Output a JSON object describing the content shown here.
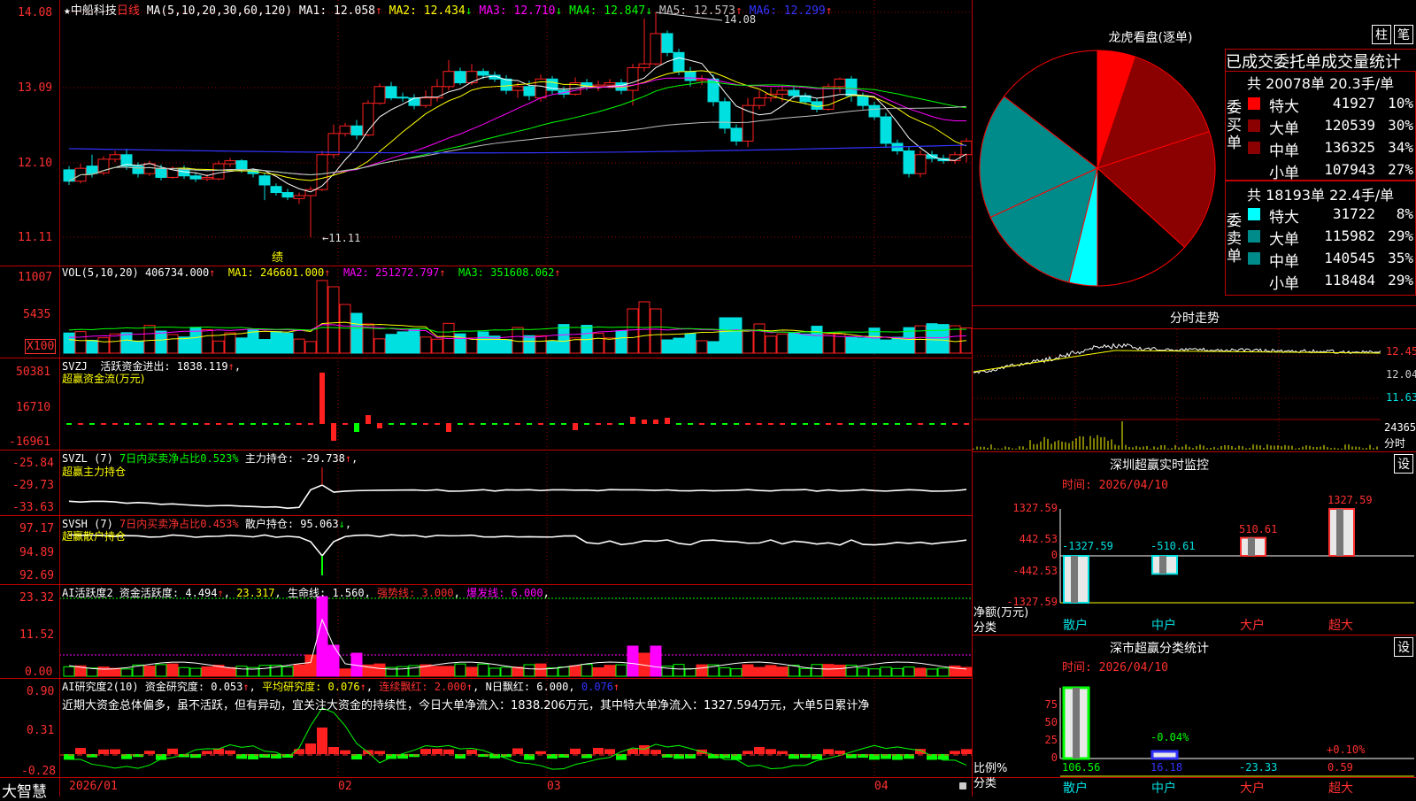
{
  "app": {
    "logo": "大智慧"
  },
  "stock": {
    "star": "★",
    "name": "中船科技",
    "period": "日线",
    "ma_def": "MA(5,10,20,30,60,120)",
    "ma_values": [
      {
        "label": "MA1:",
        "value": "12.058",
        "arrow": "↑",
        "color": "#ffffff"
      },
      {
        "label": "MA2:",
        "value": "12.434",
        "arrow": "↓",
        "color": "#ffff00"
      },
      {
        "label": "MA3:",
        "value": "12.710",
        "arrow": "↓",
        "color": "#ff00ff"
      },
      {
        "label": "MA4:",
        "value": "12.847",
        "arrow": "↓",
        "color": "#00ff00"
      },
      {
        "label": "MA5:",
        "value": "12.573",
        "arrow": "↑",
        "color": "#c0c0c0"
      },
      {
        "label": "MA6:",
        "value": "12.299",
        "arrow": "↑",
        "color": "#3333ff"
      }
    ]
  },
  "main": {
    "yticks": [
      "14.08",
      "13.09",
      "12.10",
      "11.11"
    ],
    "max_label": "14.08",
    "min_label": "←11.11",
    "event_label": "绩",
    "date_ticks": [
      "2026/01",
      "02",
      "03",
      "04"
    ]
  },
  "colors": {
    "up": "#ff2020",
    "down": "#00e0e0",
    "grid": "#9b0000",
    "axis": "#ff3030"
  },
  "candles": [
    [
      12.0,
      11.85,
      12.05,
      11.8
    ],
    [
      11.85,
      12.02,
      12.08,
      11.82
    ],
    [
      12.05,
      11.95,
      12.2,
      11.9
    ],
    [
      11.96,
      12.14,
      12.18,
      11.93
    ],
    [
      12.14,
      12.2,
      12.25,
      12.1
    ],
    [
      12.2,
      12.05,
      12.28,
      12.0
    ],
    [
      12.05,
      11.95,
      12.1,
      11.9
    ],
    [
      11.95,
      12.08,
      12.12,
      11.92
    ],
    [
      12.02,
      11.9,
      12.07,
      11.86
    ],
    [
      11.9,
      12.02,
      12.05,
      11.88
    ],
    [
      12.02,
      11.92,
      12.06,
      11.88
    ],
    [
      11.92,
      11.88,
      11.96,
      11.84
    ],
    [
      11.88,
      11.9,
      11.94,
      11.85
    ],
    [
      11.88,
      12.08,
      12.12,
      11.86
    ],
    [
      12.08,
      12.12,
      12.16,
      12.04
    ],
    [
      12.12,
      12.0,
      12.14,
      11.96
    ],
    [
      12.0,
      11.95,
      12.02,
      11.9
    ],
    [
      11.92,
      11.8,
      11.96,
      11.6
    ],
    [
      11.78,
      11.7,
      11.82,
      11.66
    ],
    [
      11.7,
      11.64,
      11.75,
      11.6
    ],
    [
      11.62,
      11.66,
      11.7,
      11.55
    ],
    [
      11.66,
      11.74,
      11.78,
      11.11
    ],
    [
      11.74,
      12.2,
      12.25,
      11.72
    ],
    [
      12.2,
      12.48,
      12.6,
      12.15
    ],
    [
      12.48,
      12.58,
      12.62,
      12.44
    ],
    [
      12.58,
      12.46,
      12.66,
      12.4
    ],
    [
      12.46,
      12.88,
      12.92,
      12.44
    ],
    [
      12.88,
      13.1,
      13.14,
      12.86
    ],
    [
      13.1,
      12.95,
      13.16,
      12.92
    ],
    [
      12.96,
      12.95,
      13.02,
      12.9
    ],
    [
      12.95,
      12.85,
      13.0,
      12.8
    ],
    [
      12.85,
      12.95,
      13.05,
      12.82
    ],
    [
      12.95,
      13.1,
      13.2,
      12.9
    ],
    [
      13.1,
      13.3,
      13.45,
      13.05
    ],
    [
      13.3,
      13.15,
      13.35,
      13.12
    ],
    [
      13.15,
      13.3,
      13.4,
      13.12
    ],
    [
      13.3,
      13.25,
      13.34,
      13.2
    ],
    [
      13.25,
      13.2,
      13.3,
      13.16
    ],
    [
      13.2,
      13.05,
      13.25,
      13.0
    ],
    [
      13.05,
      13.1,
      13.15,
      12.95
    ],
    [
      13.1,
      12.98,
      13.18,
      12.92
    ],
    [
      12.95,
      13.2,
      13.26,
      12.9
    ],
    [
      13.2,
      13.05,
      13.24,
      13.0
    ],
    [
      13.05,
      13.0,
      13.1,
      12.95
    ],
    [
      13.0,
      13.15,
      13.22,
      12.98
    ],
    [
      13.15,
      13.1,
      13.2,
      13.05
    ],
    [
      13.1,
      13.12,
      13.18,
      13.04
    ],
    [
      13.12,
      13.15,
      13.2,
      13.08
    ],
    [
      13.15,
      13.05,
      13.2,
      13.0
    ],
    [
      13.05,
      13.35,
      13.4,
      12.85
    ],
    [
      13.35,
      13.4,
      14.0,
      13.3
    ],
    [
      13.4,
      13.8,
      14.08,
      13.38
    ],
    [
      13.8,
      13.55,
      13.84,
      13.5
    ],
    [
      13.55,
      13.3,
      13.6,
      13.25
    ],
    [
      13.3,
      13.18,
      13.36,
      13.1
    ],
    [
      13.18,
      13.2,
      13.25,
      13.12
    ],
    [
      13.2,
      12.9,
      13.26,
      12.84
    ],
    [
      12.9,
      12.55,
      12.95,
      12.48
    ],
    [
      12.55,
      12.38,
      12.6,
      12.32
    ],
    [
      12.38,
      12.85,
      12.95,
      12.3
    ],
    [
      12.85,
      12.95,
      13.05,
      12.8
    ],
    [
      12.95,
      13.0,
      13.08,
      12.9
    ],
    [
      13.0,
      13.05,
      13.1,
      12.9
    ],
    [
      13.05,
      12.98,
      13.1,
      12.94
    ],
    [
      12.98,
      12.9,
      13.02,
      12.86
    ],
    [
      12.9,
      12.8,
      12.94,
      12.76
    ],
    [
      12.8,
      13.1,
      13.14,
      12.78
    ],
    [
      13.1,
      13.2,
      13.22,
      13.02
    ],
    [
      13.2,
      12.98,
      13.24,
      12.9
    ],
    [
      12.98,
      12.85,
      13.02,
      12.8
    ],
    [
      12.85,
      12.7,
      12.9,
      12.66
    ],
    [
      12.7,
      12.35,
      12.75,
      12.3
    ],
    [
      12.35,
      12.25,
      12.4,
      12.2
    ],
    [
      12.25,
      11.95,
      12.3,
      11.9
    ],
    [
      11.95,
      12.2,
      12.26,
      11.9
    ],
    [
      12.2,
      12.15,
      12.25,
      12.1
    ],
    [
      12.15,
      12.12,
      12.2,
      12.08
    ],
    [
      12.12,
      12.2,
      12.24,
      12.08
    ],
    [
      12.2,
      12.38,
      12.42,
      12.1
    ]
  ],
  "vol": {
    "def": "VOL(5,10,20)",
    "val": "406734.000",
    "ma1": "MA1: 246601.000",
    "ma2": "MA2: 251272.797",
    "ma3": "MA3: 351608.062",
    "yticks": [
      "11007",
      "5435"
    ],
    "unit": "X100"
  },
  "svzj": {
    "name": "SVZJ",
    "label": "活跃资金进出: 1838.119",
    "sub": "超赢资金流(万元)",
    "yticks": [
      "50381",
      "16710",
      "-16961"
    ]
  },
  "svzl": {
    "name": "SVZL (7)",
    "t1": "7日内买卖净占比0.523%",
    "t2": "主力持仓: -29.738",
    "sub": "超赢主力持仓",
    "yticks": [
      "-25.84",
      "-29.73",
      "-33.63"
    ]
  },
  "svsh": {
    "name": "SVSH (7)",
    "t1": "7日内买卖净占比0.453%",
    "t2": "散户持仓: 95.063",
    "sub": "超赢散户持仓",
    "yticks": [
      "97.17",
      "94.89",
      "92.69"
    ]
  },
  "ai_active": {
    "name": "AI活跃度2",
    "t1": "资金活跃度: 4.494",
    "t2": "23.317",
    "t3": "生命线: 1.560",
    "t4": "强势线: 3.000",
    "t5": "爆发线: 6.000",
    "yticks": [
      "23.32",
      "11.52",
      "0.00"
    ]
  },
  "ai_research": {
    "name": "AI研究度2(10)",
    "t1": "资金研究度: 0.053",
    "t2": "平均研究度: 0.076",
    "t3": "连续飘红: 2.000",
    "t4": "N日飘红: 6.000",
    "t5": "0.076",
    "yticks": [
      "0.90",
      "0.31",
      "-0.28"
    ],
    "comment": "近期大资金总体偏多，虽不活跃，但有异动，宜关注大资金的持续性，今日大单净流入：1838.206万元，其中特大单净流入：1327.594万元，大单5日累计净"
  },
  "dragon": {
    "title": "龙虎看盘(逐单)",
    "btn_pillar": "柱",
    "btn_pen": "笔",
    "tab": "已成交委托单成交量统计",
    "buy_side": "委买单",
    "sell_side": "委卖单",
    "buy_summary": "共 20078单 20.3手/单",
    "sell_summary": "共 18193单 22.4手/单",
    "buy_rows": [
      {
        "cat": "特大",
        "val": "41927",
        "pct": "10%",
        "color": "#ff0000"
      },
      {
        "cat": "大单",
        "val": "120539",
        "pct": "30%",
        "color": "#8b0000"
      },
      {
        "cat": "中单",
        "val": "136325",
        "pct": "34%",
        "color": "#8b0000"
      },
      {
        "cat": "小单",
        "val": "107943",
        "pct": "27%",
        "color": "#000000"
      }
    ],
    "sell_rows": [
      {
        "cat": "特大",
        "val": "31722",
        "pct": "8%",
        "color": "#00ffff"
      },
      {
        "cat": "大单",
        "val": "115982",
        "pct": "29%",
        "color": "#008b8b"
      },
      {
        "cat": "中单",
        "val": "140545",
        "pct": "35%",
        "color": "#008b8b"
      },
      {
        "cat": "小单",
        "val": "118484",
        "pct": "29%",
        "color": "#000000"
      }
    ]
  },
  "intraday": {
    "title": "分时走势",
    "yticks": [
      "12.45",
      "12.04",
      "11.63"
    ],
    "vol_tick": "24365",
    "vol_label": "分时"
  },
  "sz_monitor": {
    "title": "深圳超赢实时监控",
    "time": "时间: 2026/04/10",
    "btn": "设",
    "yticks": [
      "1327.59",
      "442.53",
      "0",
      "-442.53",
      "-1327.59"
    ],
    "ylabel": "净额(万元)",
    "xlabel": "分类",
    "bars": [
      {
        "cat": "散户",
        "value": -1327.59,
        "label": "-1327.59"
      },
      {
        "cat": "中户",
        "value": -510.61,
        "label": "-510.61"
      },
      {
        "cat": "大户",
        "value": 510.61,
        "label": "510.61"
      },
      {
        "cat": "超大",
        "value": 1327.59,
        "label": "1327.59"
      }
    ]
  },
  "sz_class": {
    "title": "深市超赢分类统计",
    "time": "时间: 2026/04/10",
    "btn": "设",
    "yticks": [
      "75",
      "50",
      "25",
      "0"
    ],
    "ylabel": "比例%",
    "xlabel": "分类",
    "bars": [
      {
        "cat": "散户",
        "value": 106.56,
        "label": "106.56",
        "top": ""
      },
      {
        "cat": "中户",
        "value": 16.18,
        "label": "16.18",
        "top": "-0.04%"
      },
      {
        "cat": "大户",
        "value": -23.33,
        "label": "-23.33",
        "top": ""
      },
      {
        "cat": "超大",
        "value": 0.59,
        "label": "0.59",
        "top": "+0.10%"
      }
    ]
  }
}
